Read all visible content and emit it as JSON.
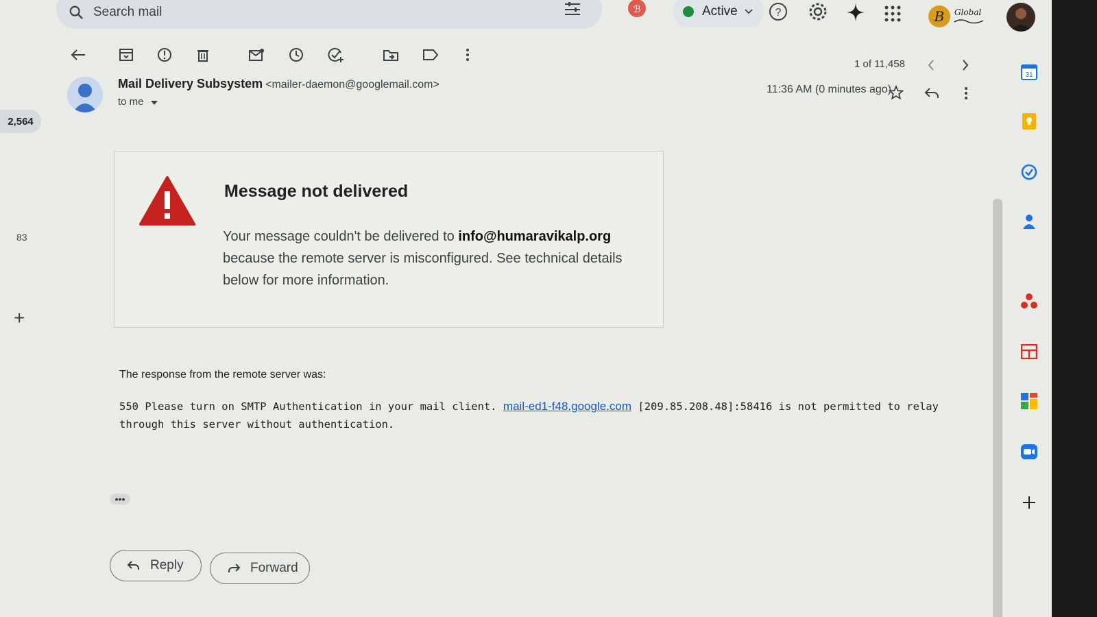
{
  "search": {
    "placeholder": "Search mail"
  },
  "header": {
    "status_label": "Active",
    "brand_text": "Global"
  },
  "toolbar": {
    "pager_text": "1 of 11,458"
  },
  "leftrail": {
    "inbox_count": "2,564",
    "label_count": "83",
    "add_label": "+"
  },
  "message": {
    "sender_name": "Mail Delivery Subsystem",
    "sender_email": "<mailer-daemon@googlemail.com>",
    "to_label": "to me",
    "timestamp": "11:36 AM (0 minutes ago)",
    "notice_title": "Message not delivered",
    "notice_body_prefix": "Your message couldn't be delivered to ",
    "notice_recipient": "info@humaravikalp.org",
    "notice_body_suffix": " because the remote server is misconfigured. See technical details below for more information.",
    "response_label": "The response from the remote server was:",
    "response_prefix": "550 Please turn on SMTP Authentication in your mail client. ",
    "response_link": "mail-ed1-f48.google.com",
    "response_suffix": " [209.85.208.48]:58416 is not permitted to relay through this server without authentication.",
    "more_dots": "•••"
  },
  "actions": {
    "reply_label": "Reply",
    "forward_label": "Forward"
  },
  "colors": {
    "warning": "#c5221f",
    "link": "#1a55c4",
    "active_dot": "#1e8e3e"
  }
}
